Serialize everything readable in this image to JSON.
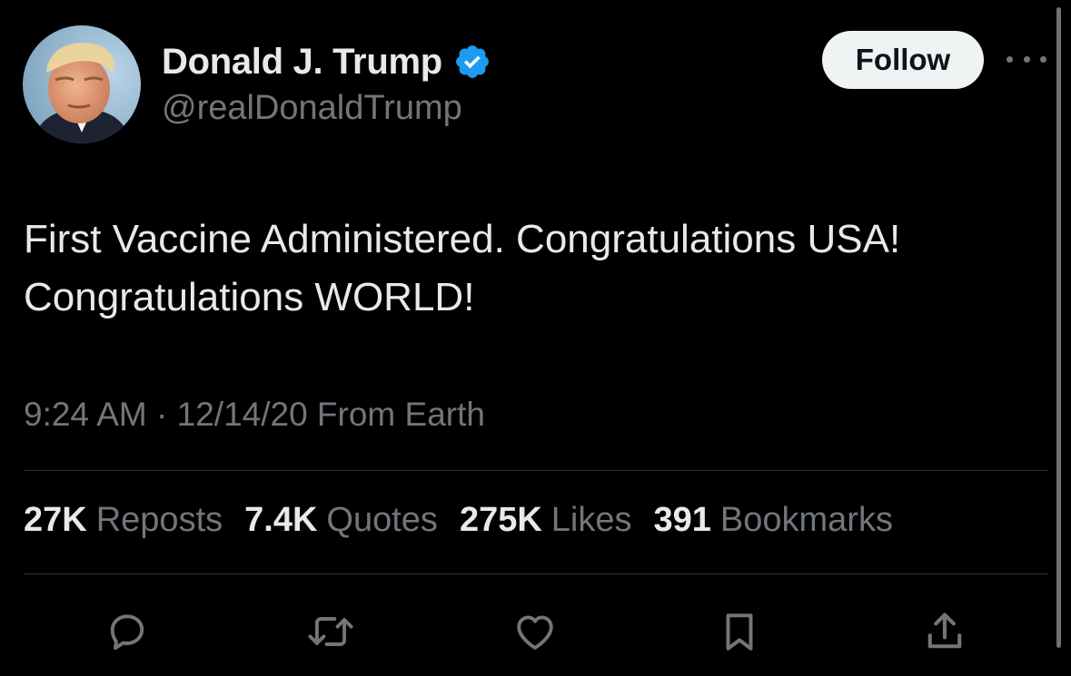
{
  "author": {
    "display_name": "Donald J. Trump",
    "handle": "@realDonaldTrump",
    "verified_icon": "verified-badge-icon"
  },
  "header": {
    "follow_label": "Follow",
    "more_icon": "more-options-icon"
  },
  "tweet": {
    "text": "First Vaccine Administered. Congratulations USA!\nCongratulations WORLD!",
    "meta": "9:24 AM · 12/14/20 From Earth"
  },
  "stats": [
    {
      "count": "27K",
      "label": "Reposts"
    },
    {
      "count": "7.4K",
      "label": "Quotes"
    },
    {
      "count": "275K",
      "label": "Likes"
    },
    {
      "count": "391",
      "label": "Bookmarks"
    }
  ],
  "actions": [
    {
      "name": "reply-icon"
    },
    {
      "name": "repost-icon"
    },
    {
      "name": "like-icon"
    },
    {
      "name": "bookmark-icon"
    },
    {
      "name": "share-icon"
    }
  ],
  "colors": {
    "background": "#000000",
    "primary_text": "#e7e9ea",
    "secondary_text": "#71767b",
    "verified_blue": "#1d9bf0",
    "divider": "#2f3336",
    "follow_bg": "#eff3f4"
  }
}
